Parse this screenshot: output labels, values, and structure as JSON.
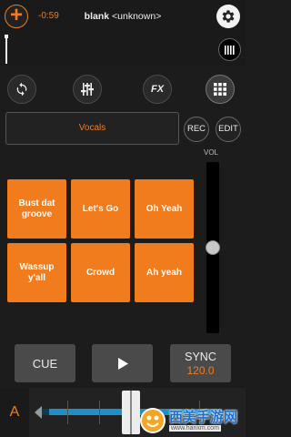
{
  "header": {
    "add_icon": "plus-icon",
    "elapsed_time": "-0:59",
    "track_title": "blank",
    "track_artist": "<unknown>",
    "settings_icon": "gear-icon"
  },
  "waveform": {
    "view_icon": "bars-icon"
  },
  "toolbar": {
    "sync_icon": "refresh-icon",
    "mixer_icon": "sliders-icon",
    "fx_label": "FX",
    "sampler_icon": "grid-icon"
  },
  "sampler": {
    "pack_name": "Vocals",
    "rec_label": "REC",
    "edit_label": "EDIT",
    "vol_label": "VOL",
    "volume_level": 0.5,
    "pads": [
      "Bust dat groove",
      "Let's Go",
      "Oh Yeah",
      "Wassup y'all",
      "Crowd",
      "Ah yeah"
    ]
  },
  "transport": {
    "cue_label": "CUE",
    "play_icon": "play-icon",
    "sync_label": "SYNC",
    "bpm": "120.0"
  },
  "deck": {
    "letter": "A",
    "pitch_value": 0.5
  },
  "watermark": {
    "text": "西美手游网",
    "url": "www.hanxm.com"
  },
  "colors": {
    "accent": "#f07c1e",
    "pitch_blue": "#1e8fc8",
    "background": "#1c1c1c"
  }
}
